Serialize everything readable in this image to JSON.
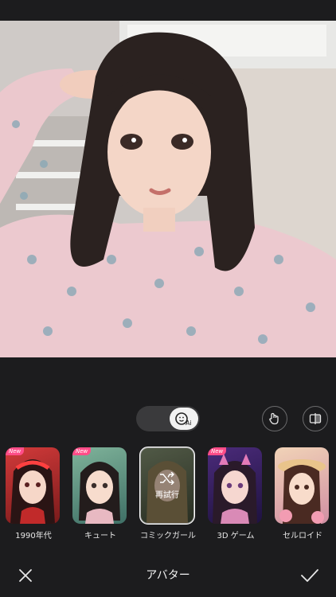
{
  "toolbar": {
    "title": "アバター"
  },
  "toggle": {
    "ai_label": "Ai"
  },
  "styles": [
    {
      "label": "1990年代",
      "badge": "New"
    },
    {
      "label": "キュート",
      "badge": "New"
    },
    {
      "label": "コミックガール",
      "overlay": "再試行"
    },
    {
      "label": "3D ゲーム",
      "badge": "New"
    },
    {
      "label": "セルロイド",
      "badge": ""
    }
  ],
  "colors": {
    "background": "#1c1c1e",
    "badge": "#ff4d88"
  }
}
